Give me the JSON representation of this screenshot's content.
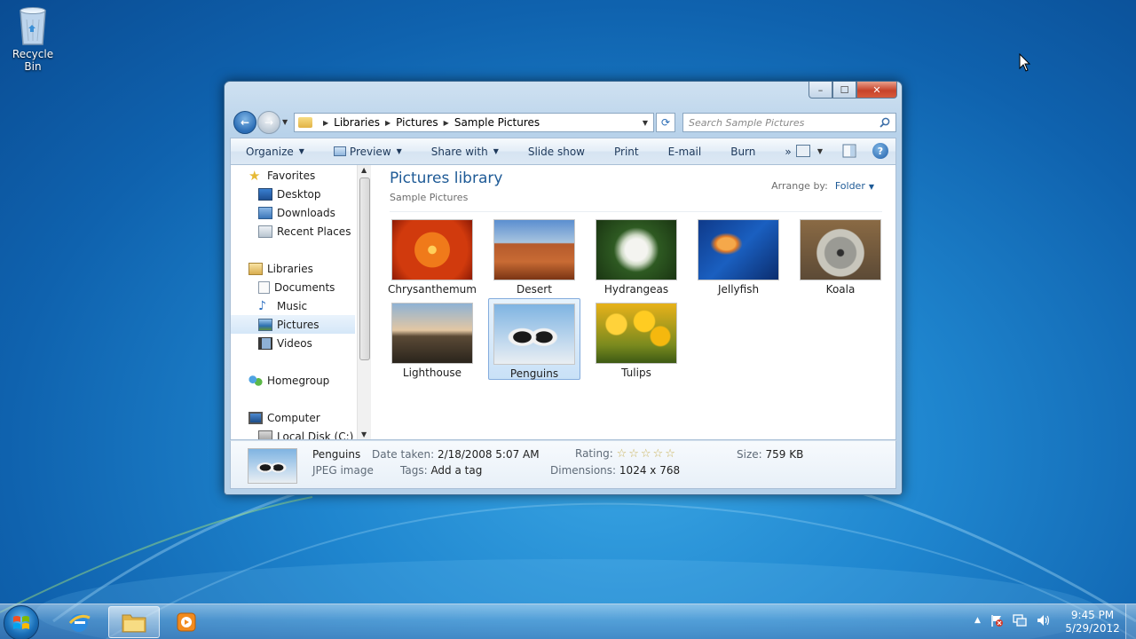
{
  "desktop": {
    "recycle_bin_label": "Recycle Bin"
  },
  "window": {
    "controls": {
      "minimize": "–",
      "maximize": "☐",
      "close": "✕"
    },
    "address": {
      "crumbs": [
        "Libraries",
        "Pictures",
        "Sample Pictures"
      ]
    },
    "search": {
      "placeholder": "Search Sample Pictures"
    },
    "toolbar": {
      "organize": "Organize",
      "preview": "Preview",
      "share_with": "Share with",
      "slide_show": "Slide show",
      "print": "Print",
      "email": "E-mail",
      "burn": "Burn",
      "more": "»"
    },
    "nav": {
      "favorites": "Favorites",
      "desktop": "Desktop",
      "downloads": "Downloads",
      "recent_places": "Recent Places",
      "libraries": "Libraries",
      "documents": "Documents",
      "music": "Music",
      "pictures": "Pictures",
      "videos": "Videos",
      "homegroup": "Homegroup",
      "computer": "Computer",
      "local_disk": "Local Disk (C:)"
    },
    "content": {
      "title": "Pictures library",
      "subtitle": "Sample Pictures",
      "arrange_by_label": "Arrange by:",
      "arrange_by_value": "Folder",
      "items": [
        {
          "name": "Chrysanthemum"
        },
        {
          "name": "Desert"
        },
        {
          "name": "Hydrangeas"
        },
        {
          "name": "Jellyfish"
        },
        {
          "name": "Koala"
        },
        {
          "name": "Lighthouse"
        },
        {
          "name": "Penguins",
          "selected": true
        },
        {
          "name": "Tulips"
        }
      ]
    },
    "details": {
      "name": "Penguins",
      "type": "JPEG image",
      "date_taken_label": "Date taken:",
      "date_taken": "2/18/2008 5:07 AM",
      "tags_label": "Tags:",
      "tags": "Add a tag",
      "rating_label": "Rating:",
      "rating_stars": 0,
      "rating_max": 5,
      "dimensions_label": "Dimensions:",
      "dimensions": "1024 x 768",
      "size_label": "Size:",
      "size": "759 KB"
    }
  },
  "taskbar": {
    "clock_time": "9:45 PM",
    "clock_date": "5/29/2012",
    "tray_show_hidden": "▲"
  }
}
